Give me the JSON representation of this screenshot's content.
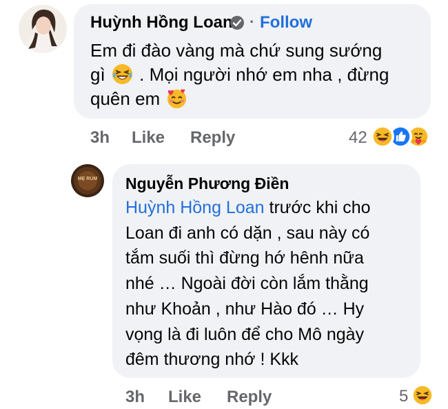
{
  "comment1": {
    "author": "Huỳnh Hồng Loan",
    "separator": "·",
    "follow_label": "Follow",
    "lines": [
      "Em đi đào vàng mà chứ sung sướng",
      "gì",
      ". Mọi người nhớ em nha , đừng",
      "quên em"
    ],
    "emojis": [
      "laughing-tears-emoji",
      "smiling-face-with-hearts-emoji"
    ],
    "time": "3h",
    "like_label": "Like",
    "reply_label": "Reply",
    "reaction_count": "42",
    "reactions": [
      "haha",
      "like",
      "care"
    ]
  },
  "comment2": {
    "author": "Nguyễn Phương Điền",
    "mention": "Huỳnh Hồng Loan",
    "lines": [
      "trước khi cho",
      "Loan đi anh có dặn , sau này có",
      "tắm suối thì đừng hớ hênh nữa",
      "nhé … Ngoài đời còn lắm thằng",
      "như Khoản , như Hào đó … Hy",
      "vọng là đi luôn để cho Mô ngày",
      "đêm thương nhớ ! Kkk"
    ],
    "avatar_text": "MẸ RUM",
    "time": "3h",
    "like_label": "Like",
    "reply_label": "Reply",
    "reaction_count": "5",
    "reactions": [
      "haha"
    ]
  },
  "colors": {
    "bubble": "#f0f2f5",
    "link": "#216fdb",
    "meta": "#65676b",
    "text": "#050505"
  }
}
